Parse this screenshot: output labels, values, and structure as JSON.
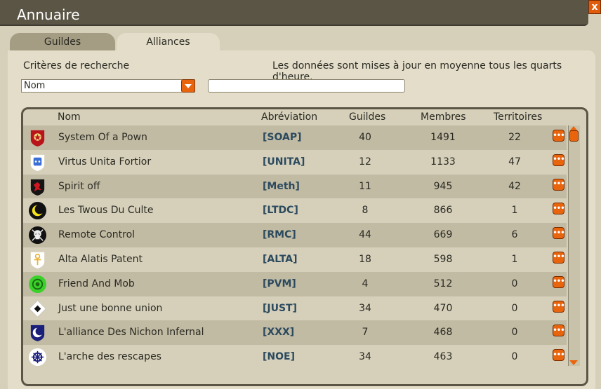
{
  "window": {
    "title": "Annuaire",
    "close_label": "x"
  },
  "tabs": [
    {
      "label": "Guildes",
      "active": false
    },
    {
      "label": "Alliances",
      "active": true
    }
  ],
  "search": {
    "criteria_label": "Critères de recherche",
    "info": "Les données sont mises à jour en moyenne tous les quarts d'heure.",
    "select_value": "Nom",
    "input_value": ""
  },
  "table": {
    "headers": {
      "nom": "Nom",
      "abreviation": "Abréviation",
      "guildes": "Guildes",
      "membres": "Membres",
      "territoires": "Territoires"
    },
    "rows": [
      {
        "nom": "System Of a Pown",
        "abreviation": "[SOAP]",
        "guildes": "40",
        "membres": "1491",
        "territoires": "22",
        "emblem": "star-emblem-icon"
      },
      {
        "nom": "Virtus Unita Fortior",
        "abreviation": "[UNITA]",
        "guildes": "12",
        "membres": "1133",
        "territoires": "47",
        "emblem": "dice-emblem-icon"
      },
      {
        "nom": "Spirit off",
        "abreviation": "[Meth]",
        "guildes": "11",
        "membres": "945",
        "territoires": "42",
        "emblem": "demon-emblem-icon"
      },
      {
        "nom": "Les Twous Du Culte",
        "abreviation": "[LTDC]",
        "guildes": "8",
        "membres": "866",
        "territoires": "1",
        "emblem": "moon-emblem-icon"
      },
      {
        "nom": "Remote Control",
        "abreviation": "[RMC]",
        "guildes": "44",
        "membres": "669",
        "territoires": "6",
        "emblem": "skull-emblem-icon"
      },
      {
        "nom": "Alta Alatis Patent",
        "abreviation": "[ALTA]",
        "guildes": "18",
        "membres": "598",
        "territoires": "1",
        "emblem": "ankh-emblem-icon"
      },
      {
        "nom": "Friend And Mob",
        "abreviation": "[PVM]",
        "guildes": "4",
        "membres": "512",
        "territoires": "0",
        "emblem": "flower-emblem-icon"
      },
      {
        "nom": "Just une bonne union",
        "abreviation": "[JUST]",
        "guildes": "34",
        "membres": "470",
        "territoires": "0",
        "emblem": "diamond-emblem-icon"
      },
      {
        "nom": "L'alliance Des Nichon Infernal",
        "abreviation": "[XXX]",
        "guildes": "7",
        "membres": "468",
        "territoires": "0",
        "emblem": "crescent-shield-emblem-icon"
      },
      {
        "nom": "L'arche des rescapes",
        "abreviation": "[NOE]",
        "guildes": "34",
        "membres": "463",
        "territoires": "0",
        "emblem": "wheel-emblem-icon"
      }
    ]
  },
  "colors": {
    "accent": "#e8650e",
    "abbreviation": "#2b4a5e",
    "titlebar": "#5b5546"
  }
}
